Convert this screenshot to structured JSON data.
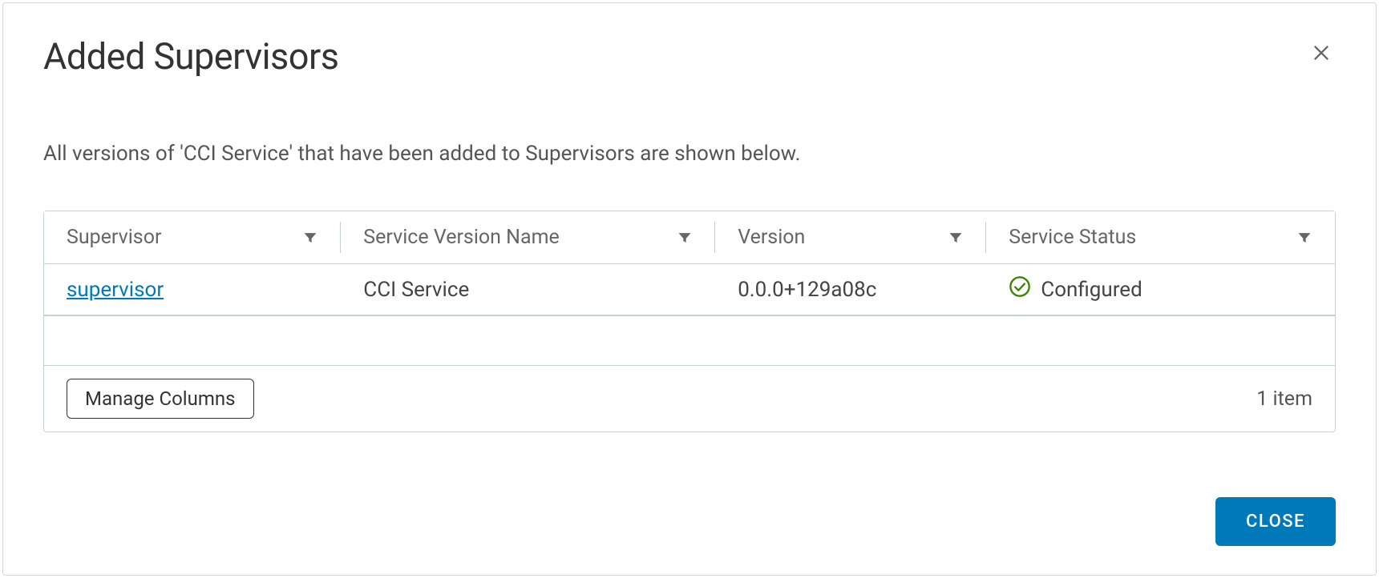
{
  "modal": {
    "title": "Added Supervisors",
    "description": "All versions of 'CCI Service' that have been added to Supervisors are shown below.",
    "close_button_label": "CLOSE"
  },
  "table": {
    "columns": [
      {
        "label": "Supervisor"
      },
      {
        "label": "Service Version Name"
      },
      {
        "label": "Version"
      },
      {
        "label": "Service Status"
      }
    ],
    "rows": [
      {
        "supervisor": "supervisor",
        "service_version_name": "CCI Service",
        "version": "0.0.0+129a08c",
        "service_status": "Configured",
        "status_icon": "check-circle"
      }
    ],
    "manage_columns_label": "Manage Columns",
    "item_count_label": "1 item"
  }
}
